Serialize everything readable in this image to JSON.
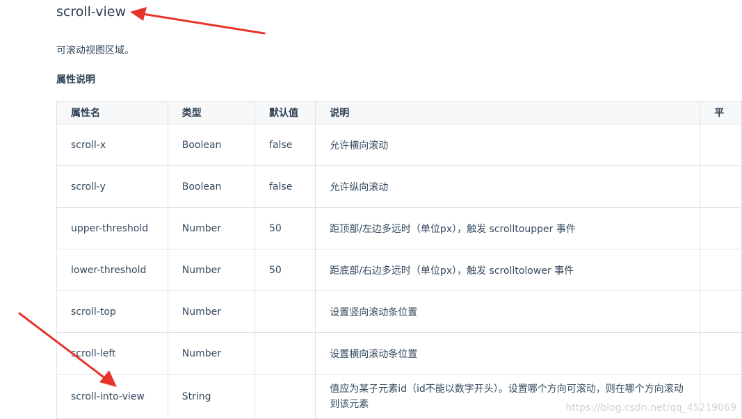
{
  "title": "scroll-view",
  "description": "可滚动视图区域。",
  "section_title": "属性说明",
  "table": {
    "headers": [
      "属性名",
      "类型",
      "默认值",
      "说明",
      "平"
    ],
    "rows": [
      {
        "name": "scroll-x",
        "type": "Boolean",
        "default": "false",
        "desc": "允许横向滚动"
      },
      {
        "name": "scroll-y",
        "type": "Boolean",
        "default": "false",
        "desc": "允许纵向滚动"
      },
      {
        "name": "upper-threshold",
        "type": "Number",
        "default": "50",
        "desc": "距顶部/左边多远时（单位px），触发 scrolltoupper 事件"
      },
      {
        "name": "lower-threshold",
        "type": "Number",
        "default": "50",
        "desc": "距底部/右边多远时（单位px），触发 scrolltolower 事件"
      },
      {
        "name": "scroll-top",
        "type": "Number",
        "default": "",
        "desc": "设置竖向滚动条位置"
      },
      {
        "name": "scroll-left",
        "type": "Number",
        "default": "",
        "desc": "设置横向滚动条位置"
      },
      {
        "name": "scroll-into-view",
        "type": "String",
        "default": "",
        "desc": "值应为某子元素id（id不能以数字开头）。设置哪个方向可滚动，则在哪个方向滚动到该元素"
      }
    ]
  },
  "watermark": "https://blog.csdn.net/qq_45219069",
  "colors": {
    "annotation_arrow": "#e8332b",
    "border": "#dfe2e5",
    "header_bg": "#f6f8fa"
  }
}
